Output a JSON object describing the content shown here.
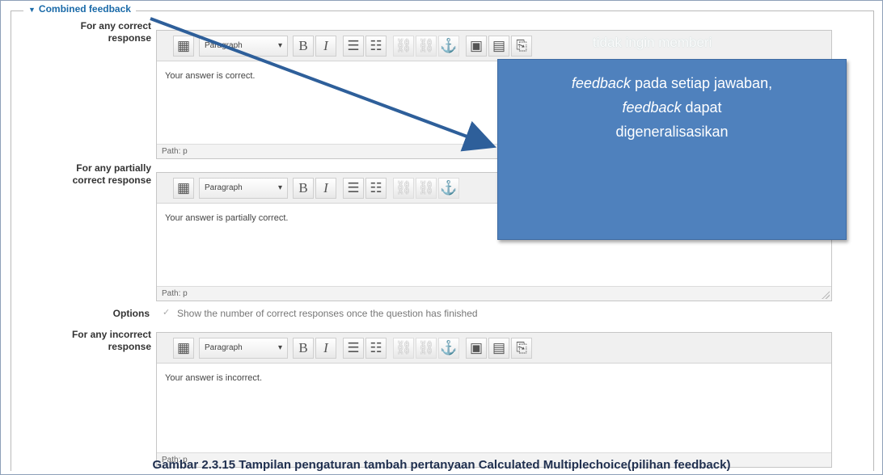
{
  "fieldset": {
    "legend": "Combined feedback"
  },
  "editors": [
    {
      "label_line1": "For any correct",
      "label_line2": "response",
      "format": "Paragraph",
      "content": "Your answer is correct.",
      "path": "Path: p"
    },
    {
      "label_line1": "For any partially",
      "label_line2": "correct response",
      "format": "Paragraph",
      "content": "Your answer is partially correct.",
      "path": "Path: p"
    },
    {
      "label_line1": "For any incorrect",
      "label_line2": "response",
      "format": "Paragraph",
      "content": "Your answer is incorrect.",
      "path": "Path: p"
    }
  ],
  "options": {
    "label": "Options",
    "checkbox_text": "Show the number of correct responses once the question has finished",
    "checked": true
  },
  "toolbar": {
    "bold": "B",
    "italic": "I",
    "icons": [
      "editor-icon",
      "bold-icon",
      "italic-icon",
      "bullet-list-icon",
      "numbered-list-icon",
      "link-icon",
      "unlink-icon",
      "anchor-icon",
      "image-icon",
      "media-icon",
      "paste-icon"
    ]
  },
  "callout": {
    "top_text": "tidak ingin memberi",
    "line1_em": "feedback",
    "line1_rest": " pada setiap jawaban,",
    "line2_em": "feedback",
    "line2_rest": " dapat",
    "line3": "digeneralisasikan",
    "color": "#4f81bd"
  },
  "caption": "Gambar 2.3.15 Tampilan pengaturan tambah pertanyaan Calculated Multiplechoice(pilihan feedback)"
}
